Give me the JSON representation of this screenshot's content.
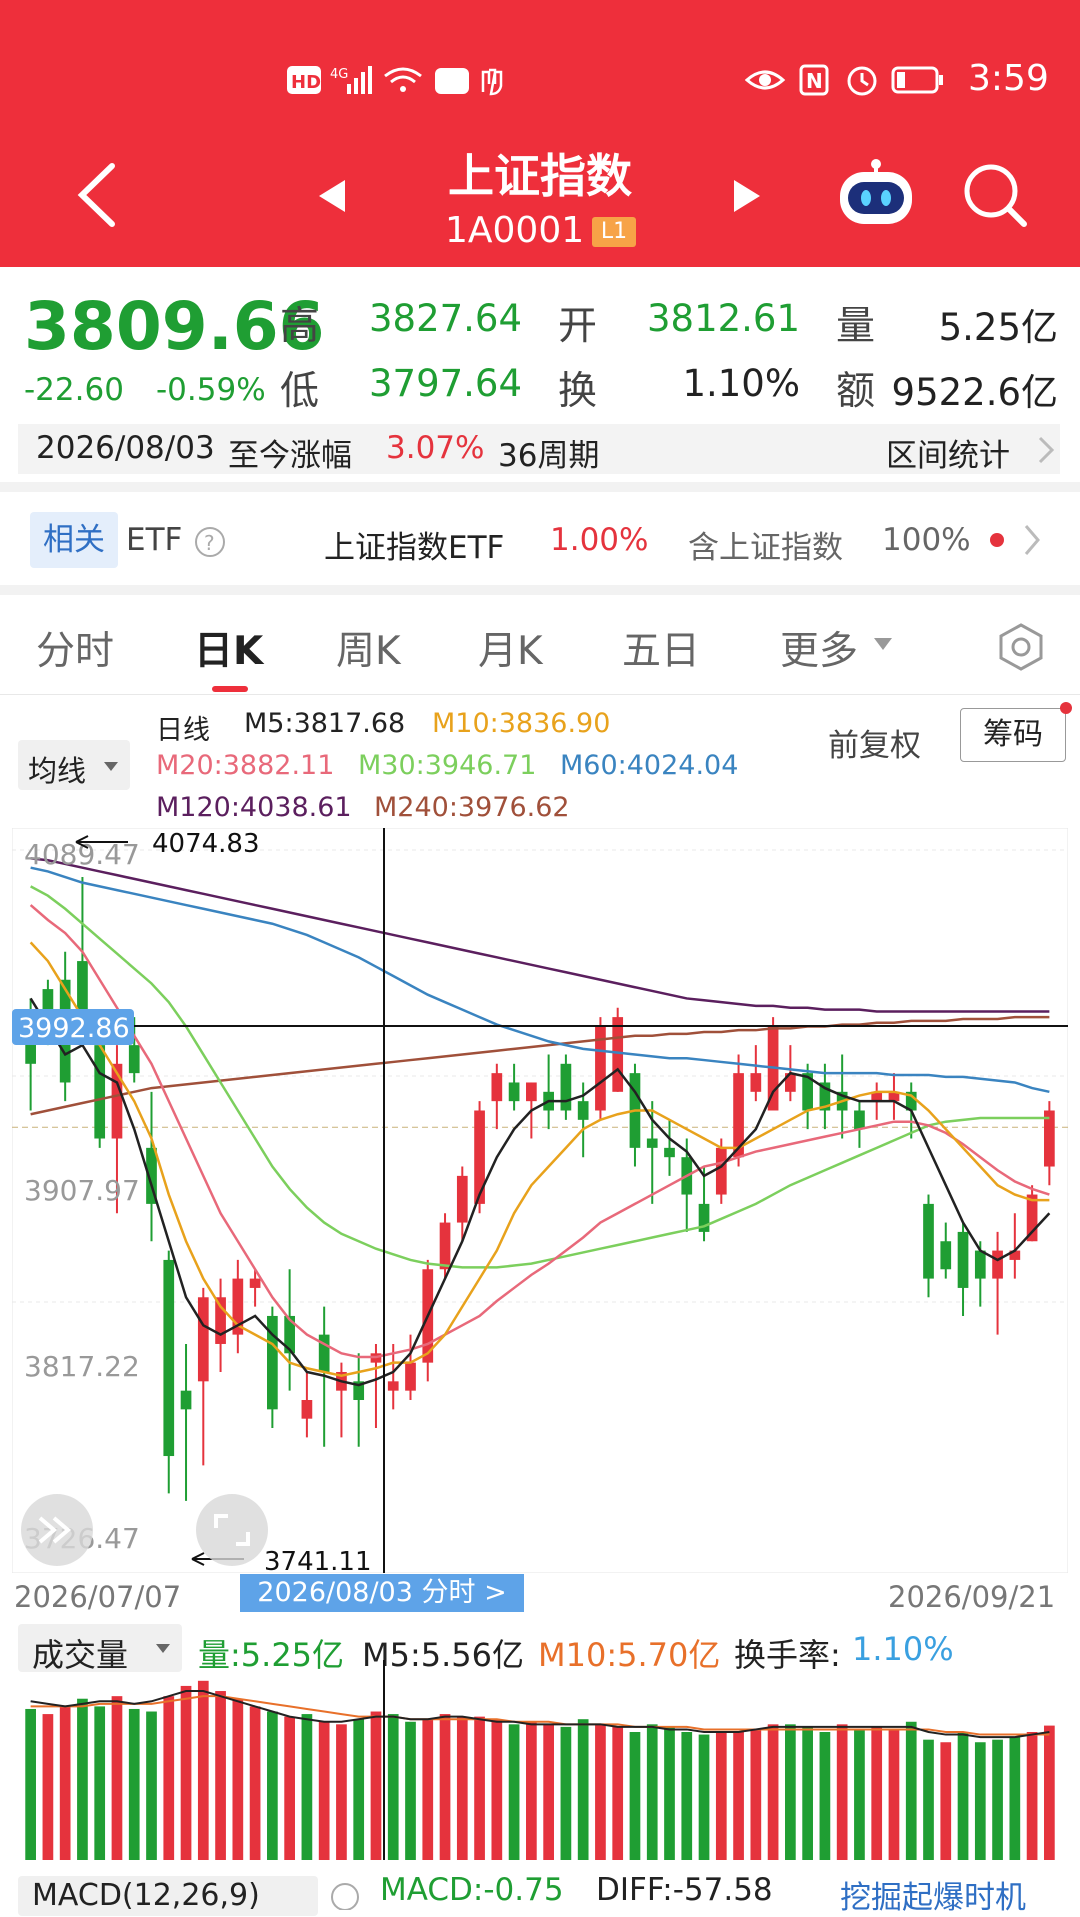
{
  "status_bar": {
    "time": "3:59"
  },
  "header": {
    "title": "上证指数",
    "code": "1A0001",
    "badge": "L1"
  },
  "quote": {
    "price": "3809.66",
    "change": "-22.60",
    "change_pct": "-0.59%",
    "high_label": "高",
    "high": "3827.64",
    "low_label": "低",
    "low": "3797.64",
    "open_label": "开",
    "open": "3812.61",
    "turnover_label": "换",
    "turnover": "1.10%",
    "volume_label": "量",
    "volume": "5.25亿",
    "amount_label": "额",
    "amount": "9522.6亿"
  },
  "range": {
    "date": "2026/08/03",
    "text": "至今涨幅",
    "pct": "3.07%",
    "period": "36周期",
    "stat_label": "区间统计"
  },
  "related": {
    "badge": "相关",
    "etf": "ETF",
    "fund_name": "上证指数ETF",
    "fund_pct": "1.00%",
    "holding_label": "含上证指数",
    "holding_pct": "100%"
  },
  "tabs": [
    {
      "label": "分时"
    },
    {
      "label": "日K"
    },
    {
      "label": "周K"
    },
    {
      "label": "月K"
    },
    {
      "label": "五日"
    },
    {
      "label": "更多"
    }
  ],
  "ma_legend": {
    "selector": "均线",
    "line_label": "日线",
    "m5": "M5:3817.68",
    "m10": "M10:3836.90",
    "m20": "M20:3882.11",
    "m30": "M30:3946.71",
    "m60": "M60:4024.04",
    "m120": "M120:4038.61",
    "m240": "M240:3976.62",
    "fuquan": "前复权",
    "chip": "筹码"
  },
  "colors": {
    "up": "#e5333d",
    "down": "#1f9e33",
    "header": "#ee2f3b",
    "m5": "#222222",
    "m10": "#e8a21c",
    "m20": "#e8697a",
    "m30": "#7ccf5d",
    "m60": "#3a84c0",
    "m120": "#5b1f5e",
    "m240": "#a0503a"
  },
  "chart_labels": {
    "y_top": "4089.47",
    "y_mid": "3907.97",
    "y_low": "3817.22",
    "y_bottom": "3726.47",
    "crosshair_value": "3992.86",
    "max_marker": "4074.83",
    "min_marker": "3741.11",
    "date_start": "2026/07/07",
    "date_end": "2026/09/21",
    "selected_date": "2026/08/03  分时 >"
  },
  "chart_data": {
    "type": "candlestick",
    "ylim": [
      3726.47,
      4089.47
    ],
    "candles": [
      {
        "o": 4000,
        "h": 4010,
        "l": 3950,
        "c": 3975
      },
      {
        "o": 4015,
        "h": 4020,
        "l": 3985,
        "c": 3995
      },
      {
        "o": 4020,
        "h": 4035,
        "l": 3955,
        "c": 3965
      },
      {
        "o": 4030,
        "h": 4075,
        "l": 3990,
        "c": 4000
      },
      {
        "o": 3985,
        "h": 3990,
        "l": 3930,
        "c": 3935
      },
      {
        "o": 3935,
        "h": 3985,
        "l": 3895,
        "c": 3975
      },
      {
        "o": 3985,
        "h": 4000,
        "l": 3965,
        "c": 3970
      },
      {
        "o": 3930,
        "h": 3960,
        "l": 3880,
        "c": 3900
      },
      {
        "o": 3870,
        "h": 3875,
        "l": 3745,
        "c": 3765
      },
      {
        "o": 3800,
        "h": 3825,
        "l": 3741,
        "c": 3790
      },
      {
        "o": 3805,
        "h": 3855,
        "l": 3760,
        "c": 3850
      },
      {
        "o": 3825,
        "h": 3860,
        "l": 3810,
        "c": 3850
      },
      {
        "o": 3830,
        "h": 3870,
        "l": 3820,
        "c": 3860
      },
      {
        "o": 3855,
        "h": 3865,
        "l": 3845,
        "c": 3860
      },
      {
        "o": 3840,
        "h": 3845,
        "l": 3780,
        "c": 3790
      },
      {
        "o": 3840,
        "h": 3865,
        "l": 3800,
        "c": 3820
      },
      {
        "o": 3785,
        "h": 3810,
        "l": 3775,
        "c": 3795
      },
      {
        "o": 3830,
        "h": 3845,
        "l": 3770,
        "c": 3810
      },
      {
        "o": 3800,
        "h": 3815,
        "l": 3775,
        "c": 3810
      },
      {
        "o": 3805,
        "h": 3820,
        "l": 3770,
        "c": 3795
      },
      {
        "o": 3815,
        "h": 3825,
        "l": 3780,
        "c": 3820
      },
      {
        "o": 3800,
        "h": 3825,
        "l": 3790,
        "c": 3805
      },
      {
        "o": 3800,
        "h": 3830,
        "l": 3795,
        "c": 3815
      },
      {
        "o": 3815,
        "h": 3870,
        "l": 3805,
        "c": 3865
      },
      {
        "o": 3865,
        "h": 3895,
        "l": 3860,
        "c": 3890
      },
      {
        "o": 3890,
        "h": 3920,
        "l": 3880,
        "c": 3915
      },
      {
        "o": 3900,
        "h": 3955,
        "l": 3895,
        "c": 3950
      },
      {
        "o": 3955,
        "h": 3975,
        "l": 3940,
        "c": 3970
      },
      {
        "o": 3965,
        "h": 3975,
        "l": 3950,
        "c": 3955
      },
      {
        "o": 3955,
        "h": 3965,
        "l": 3935,
        "c": 3965
      },
      {
        "o": 3960,
        "h": 3980,
        "l": 3940,
        "c": 3950
      },
      {
        "o": 3975,
        "h": 3980,
        "l": 3945,
        "c": 3950
      },
      {
        "o": 3955,
        "h": 3965,
        "l": 3925,
        "c": 3945
      },
      {
        "o": 3950,
        "h": 4000,
        "l": 3945,
        "c": 3995
      },
      {
        "o": 3960,
        "h": 4005,
        "l": 3960,
        "c": 4000
      },
      {
        "o": 3970,
        "h": 3975,
        "l": 3920,
        "c": 3930
      },
      {
        "o": 3935,
        "h": 3955,
        "l": 3900,
        "c": 3930
      },
      {
        "o": 3930,
        "h": 3945,
        "l": 3915,
        "c": 3925
      },
      {
        "o": 3925,
        "h": 3935,
        "l": 3885,
        "c": 3905
      },
      {
        "o": 3900,
        "h": 3920,
        "l": 3880,
        "c": 3885
      },
      {
        "o": 3905,
        "h": 3935,
        "l": 3900,
        "c": 3930
      },
      {
        "o": 3925,
        "h": 3980,
        "l": 3920,
        "c": 3970
      },
      {
        "o": 3960,
        "h": 3985,
        "l": 3955,
        "c": 3970
      },
      {
        "o": 3950,
        "h": 4000,
        "l": 3950,
        "c": 3995
      },
      {
        "o": 3960,
        "h": 3985,
        "l": 3955,
        "c": 3970
      },
      {
        "o": 3970,
        "h": 3975,
        "l": 3940,
        "c": 3950
      },
      {
        "o": 3965,
        "h": 3975,
        "l": 3940,
        "c": 3950
      },
      {
        "o": 3960,
        "h": 3980,
        "l": 3935,
        "c": 3950
      },
      {
        "o": 3950,
        "h": 3955,
        "l": 3930,
        "c": 3940
      },
      {
        "o": 3955,
        "h": 3965,
        "l": 3945,
        "c": 3960
      },
      {
        "o": 3955,
        "h": 3970,
        "l": 3945,
        "c": 3960
      },
      {
        "o": 3960,
        "h": 3965,
        "l": 3935,
        "c": 3950
      },
      {
        "o": 3900,
        "h": 3905,
        "l": 3850,
        "c": 3860
      },
      {
        "o": 3880,
        "h": 3890,
        "l": 3860,
        "c": 3865
      },
      {
        "o": 3885,
        "h": 3890,
        "l": 3840,
        "c": 3855
      },
      {
        "o": 3875,
        "h": 3880,
        "l": 3845,
        "c": 3860
      },
      {
        "o": 3860,
        "h": 3885,
        "l": 3830,
        "c": 3875
      },
      {
        "o": 3870,
        "h": 3895,
        "l": 3860,
        "c": 3875
      },
      {
        "o": 3880,
        "h": 3910,
        "l": 3880,
        "c": 3905
      },
      {
        "o": 3920,
        "h": 3955,
        "l": 3910,
        "c": 3950
      }
    ],
    "ma5": [
      4010,
      3995,
      3980,
      3985,
      3970,
      3965,
      3940,
      3910,
      3880,
      3850,
      3835,
      3830,
      3835,
      3840,
      3830,
      3822,
      3810,
      3808,
      3805,
      3803,
      3806,
      3810,
      3820,
      3840,
      3860,
      3880,
      3905,
      3925,
      3940,
      3950,
      3955,
      3955,
      3958,
      3965,
      3972,
      3960,
      3945,
      3935,
      3928,
      3915,
      3920,
      3930,
      3940,
      3960,
      3970,
      3968,
      3962,
      3958,
      3955,
      3955,
      3955,
      3950,
      3930,
      3910,
      3890,
      3875,
      3870,
      3875,
      3885,
      3895
    ],
    "ma10": [
      4040,
      4030,
      4015,
      4000,
      3985,
      3970,
      3955,
      3935,
      3905,
      3880,
      3860,
      3845,
      3835,
      3830,
      3825,
      3815,
      3812,
      3810,
      3808,
      3810,
      3812,
      3815,
      3815,
      3820,
      3830,
      3845,
      3860,
      3875,
      3895,
      3910,
      3920,
      3930,
      3940,
      3945,
      3948,
      3950,
      3950,
      3945,
      3940,
      3935,
      3930,
      3930,
      3935,
      3940,
      3945,
      3950,
      3952,
      3955,
      3958,
      3960,
      3960,
      3958,
      3950,
      3940,
      3930,
      3920,
      3910,
      3905,
      3902,
      3902
    ],
    "ma20": [
      4060,
      4052,
      4045,
      4035,
      4020,
      4005,
      3990,
      3975,
      3955,
      3935,
      3915,
      3895,
      3880,
      3865,
      3850,
      3838,
      3830,
      3825,
      3820,
      3818,
      3818,
      3820,
      3822,
      3825,
      3830,
      3835,
      3840,
      3848,
      3855,
      3862,
      3868,
      3875,
      3882,
      3890,
      3895,
      3900,
      3905,
      3910,
      3915,
      3920,
      3922,
      3925,
      3928,
      3930,
      3932,
      3934,
      3936,
      3938,
      3940,
      3942,
      3944,
      3944,
      3942,
      3938,
      3932,
      3925,
      3918,
      3912,
      3908,
      3905
    ],
    "m30": [
      4070,
      4065,
      4058,
      4050,
      4042,
      4034,
      4026,
      4018,
      4008,
      3995,
      3980,
      3965,
      3950,
      3935,
      3920,
      3908,
      3898,
      3890,
      3884,
      3880,
      3876,
      3873,
      3870,
      3868,
      3867,
      3866,
      3866,
      3866,
      3867,
      3868,
      3870,
      3872,
      3874,
      3876,
      3878,
      3880,
      3882,
      3884,
      3886,
      3888,
      3892,
      3896,
      3900,
      3905,
      3910,
      3914,
      3918,
      3922,
      3926,
      3930,
      3934,
      3938,
      3942,
      3944,
      3945,
      3946,
      3946,
      3946,
      3946,
      3946
    ],
    "m60": [
      4080,
      4078,
      4075,
      4072,
      4070,
      4068,
      4066,
      4064,
      4062,
      4060,
      4058,
      4056,
      4054,
      4052,
      4050,
      4047,
      4044,
      4040,
      4036,
      4032,
      4027,
      4022,
      4017,
      4012,
      4008,
      4004,
      4000,
      3996,
      3993,
      3990,
      3987,
      3985,
      3983,
      3982,
      3981,
      3980,
      3979,
      3978,
      3978,
      3977,
      3976,
      3975,
      3974,
      3973,
      3972,
      3971,
      3970,
      3970,
      3970,
      3970,
      3969,
      3969,
      3969,
      3968,
      3968,
      3967,
      3966,
      3965,
      3962,
      3960
    ],
    "m120": [
      4085,
      4084,
      4082,
      4080,
      4078,
      4076,
      4074,
      4072,
      4070,
      4068,
      4066,
      4064,
      4062,
      4060,
      4058,
      4056,
      4054,
      4052,
      4050,
      4048,
      4046,
      4044,
      4042,
      4040,
      4038,
      4036,
      4034,
      4032,
      4030,
      4028,
      4026,
      4024,
      4022,
      4020,
      4018,
      4016,
      4014,
      4012,
      4010,
      4009,
      4008,
      4007,
      4006,
      4006,
      4005,
      4005,
      4004,
      4004,
      4004,
      4003,
      4003,
      4003,
      4003,
      4003,
      4003,
      4003,
      4003,
      4003,
      4003,
      4003
    ],
    "m240": [
      3948,
      3950,
      3952,
      3954,
      3956,
      3958,
      3960,
      3962,
      3963,
      3964,
      3965,
      3966,
      3967,
      3968,
      3969,
      3970,
      3971,
      3972,
      3973,
      3974,
      3975,
      3976,
      3977,
      3978,
      3979,
      3980,
      3981,
      3982,
      3983,
      3984,
      3985,
      3986,
      3987,
      3988,
      3989,
      3990,
      3990,
      3991,
      3991,
      3992,
      3992,
      3993,
      3993,
      3994,
      3994,
      3995,
      3995,
      3996,
      3996,
      3997,
      3997,
      3998,
      3998,
      3998,
      3999,
      3999,
      3999,
      4000,
      4000,
      4000
    ],
    "volume_up": [
      false,
      true,
      true,
      false,
      false,
      true,
      false,
      false,
      true,
      true,
      true,
      true,
      true,
      true,
      false,
      true,
      false,
      true,
      true,
      false,
      true,
      false,
      false,
      true,
      true,
      true,
      true,
      true,
      false,
      true,
      true,
      false,
      false,
      true,
      true,
      false,
      false,
      false,
      false,
      false,
      true,
      true,
      true,
      true,
      false,
      false,
      false,
      true,
      false,
      true,
      true,
      false,
      false,
      true,
      false,
      false,
      false,
      false,
      true,
      true
    ],
    "volume": [
      5.9,
      5.7,
      6.0,
      6.3,
      6.0,
      6.4,
      5.9,
      5.8,
      6.4,
      6.8,
      7.0,
      6.6,
      6.3,
      6.0,
      5.8,
      5.6,
      5.7,
      5.4,
      5.3,
      5.5,
      5.8,
      5.7,
      5.4,
      5.5,
      5.7,
      5.6,
      5.6,
      5.5,
      5.3,
      5.4,
      5.3,
      5.2,
      5.5,
      5.3,
      5.2,
      5.0,
      5.3,
      5.2,
      5.0,
      4.9,
      5.0,
      5.0,
      5.1,
      5.3,
      5.3,
      5.2,
      5.0,
      5.3,
      5.1,
      5.2,
      5.1,
      5.4,
      4.7,
      4.6,
      5.0,
      4.6,
      4.7,
      4.8,
      5.0,
      5.25
    ],
    "volume_ma5": [
      6.2,
      6.1,
      6.0,
      6.1,
      6.2,
      6.2,
      6.1,
      6.2,
      6.4,
      6.6,
      6.6,
      6.4,
      6.2,
      6.0,
      5.8,
      5.6,
      5.5,
      5.4,
      5.4,
      5.5,
      5.6,
      5.6,
      5.5,
      5.5,
      5.6,
      5.6,
      5.5,
      5.4,
      5.4,
      5.3,
      5.3,
      5.3,
      5.3,
      5.3,
      5.2,
      5.2,
      5.2,
      5.1,
      5.1,
      5.0,
      5.0,
      5.0,
      5.1,
      5.2,
      5.2,
      5.2,
      5.2,
      5.2,
      5.2,
      5.2,
      5.2,
      5.2,
      5.0,
      4.9,
      4.9,
      4.8,
      4.8,
      4.8,
      4.9,
      5.0
    ],
    "volume_ma10": [
      6.0,
      6.0,
      6.0,
      6.0,
      6.1,
      6.1,
      6.1,
      6.1,
      6.2,
      6.3,
      6.4,
      6.4,
      6.3,
      6.2,
      6.1,
      6.0,
      5.9,
      5.8,
      5.7,
      5.6,
      5.6,
      5.6,
      5.5,
      5.5,
      5.5,
      5.5,
      5.5,
      5.5,
      5.4,
      5.4,
      5.4,
      5.3,
      5.3,
      5.3,
      5.3,
      5.2,
      5.2,
      5.2,
      5.2,
      5.1,
      5.1,
      5.1,
      5.1,
      5.1,
      5.1,
      5.1,
      5.1,
      5.1,
      5.1,
      5.1,
      5.1,
      5.1,
      5.1,
      5.0,
      5.0,
      4.9,
      4.9,
      4.9,
      4.9,
      4.9
    ]
  },
  "volume_legend": {
    "selector": "成交量",
    "vol": "量:5.25亿",
    "m5": "M5:5.56亿",
    "m10": "M10:5.70亿",
    "turn_label": "换手率:",
    "turn": "1.10%"
  },
  "macd": {
    "selector": "MACD(12,26,9)",
    "macd": "MACD:-0.75",
    "diff": "DIFF:-57.58",
    "action": "挖掘起爆时机"
  }
}
